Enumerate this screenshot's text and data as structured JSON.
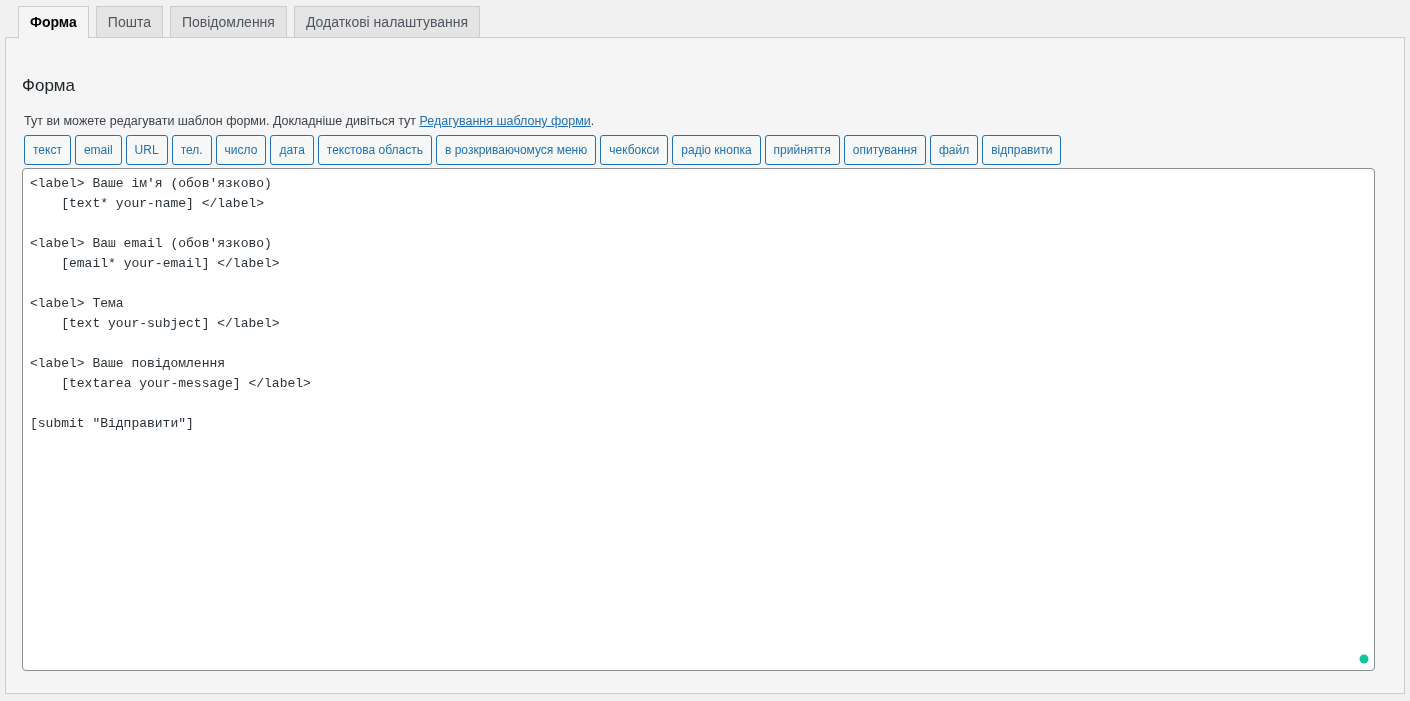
{
  "tabs": [
    {
      "label": "Форма",
      "selected": true
    },
    {
      "label": "Пошта",
      "selected": false
    },
    {
      "label": "Повідомлення",
      "selected": false
    },
    {
      "label": "Додаткові налаштування",
      "selected": false
    }
  ],
  "panel": {
    "heading": "Форма",
    "description": "Тут ви можете редагувати шаблон форми. Докладніше дивіться тут ",
    "link": "Редагування шаблону форми",
    "after_link": ".",
    "tag_buttons": [
      "текст",
      "email",
      "URL",
      "тел.",
      "число",
      "дата",
      "текстова область",
      "в розкриваючомуся меню",
      "чекбокси",
      "радіо кнопка",
      "прийняття",
      "опитування",
      "файл",
      "відправити"
    ],
    "editor": {
      "value": "<label> Ваше ім'я (обов'язково)\n    [text* your-name] </label>\n\n<label> Ваш email (обов'язково)\n    [email* your-email] </label>\n\n<label> Тема\n    [text your-subject] </label>\n\n<label> Ваше повідомлення\n    [textarea your-message] </label>\n\n[submit \"Відправити\"]"
    }
  }
}
